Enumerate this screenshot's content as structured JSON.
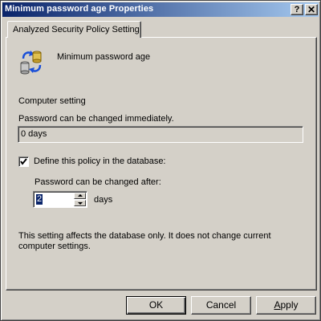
{
  "window": {
    "title": "Minimum password age Properties",
    "help_button": "?",
    "close_button": "✕"
  },
  "tab": {
    "label": "Analyzed Security Policy Setting"
  },
  "policy": {
    "name": "Minimum password age",
    "icon": "security-policy-icon"
  },
  "computer_setting": {
    "heading": "Computer setting",
    "label": "Password can be changed immediately.",
    "value": "0 days"
  },
  "define_policy": {
    "checkbox_label": "Define this policy in the database:",
    "checked": true,
    "after_label": "Password can be changed after:",
    "value": "2",
    "unit": "days"
  },
  "note": {
    "line1": "This setting affects the database only. It does not change current",
    "line2": "computer settings."
  },
  "buttons": {
    "ok": "OK",
    "cancel": "Cancel",
    "apply_prefix": "",
    "apply_accel": "A",
    "apply_rest": "pply"
  },
  "colors": {
    "titlebar_start": "#0a246a",
    "titlebar_end": "#a6caf0",
    "face": "#d4d0c8"
  }
}
